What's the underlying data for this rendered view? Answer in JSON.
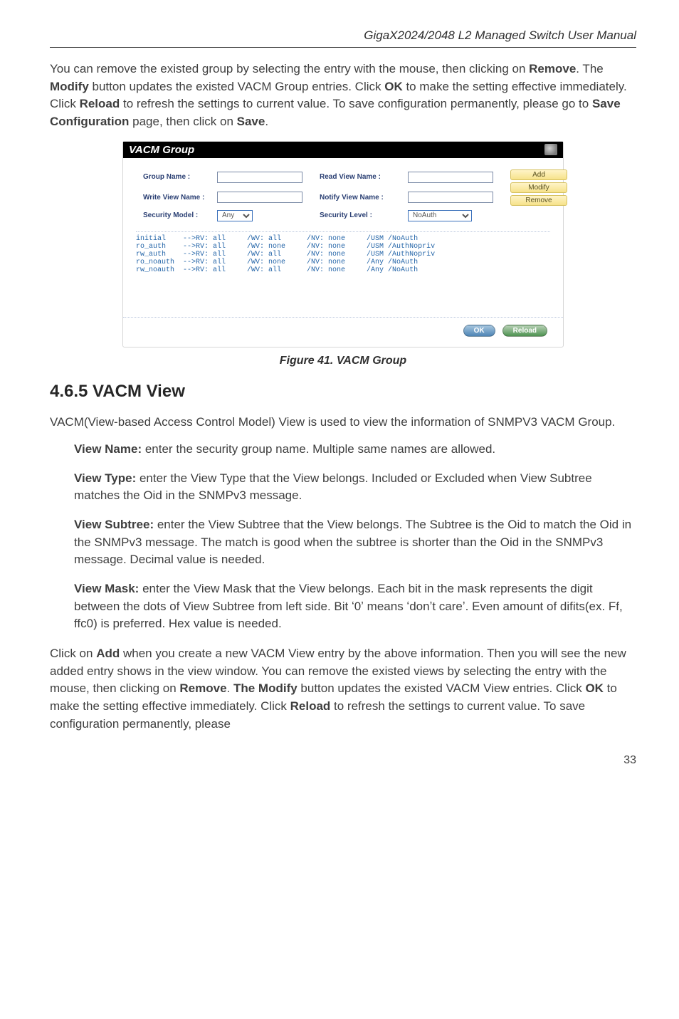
{
  "header": {
    "title": "GigaX2024/2048 L2 Managed Switch User Manual"
  },
  "intro_paragraph": {
    "t0": "You can remove the existed group by selecting the entry with the mouse, then clicking on ",
    "b1": "Remove",
    "t2": ". The ",
    "b3": "Modify",
    "t4": " button updates the existed VACM Group entries. Click ",
    "b5": "OK",
    "t6": " to make the setting effective immediately. Click ",
    "b7": "Reload",
    "t8": " to refresh the settings to current value. To save configuration permanently, please go to ",
    "b9": "Save Configuration",
    "t10": " page, then click on ",
    "b11": "Save",
    "t12": "."
  },
  "vacm": {
    "title": "VACM Group",
    "labels": {
      "group_name": "Group Name :",
      "read_view": "Read View Name :",
      "write_view": "Write View Name :",
      "notify_view": "Notify View Name :",
      "security_model": "Security Model :",
      "security_level": "Security Level :"
    },
    "selects": {
      "security_model_value": "Any",
      "security_level_value": "NoAuth"
    },
    "buttons": {
      "add": "Add",
      "modify": "Modify",
      "remove": "Remove",
      "ok": "OK",
      "reload": "Reload"
    },
    "rows": "initial    -->RV: all     /WV: all      /NV: none     /USM /NoAuth\nro_auth    -->RV: all     /WV: none     /NV: none     /USM /AuthNopriv\nrw_auth    -->RV: all     /WV: all      /NV: none     /USM /AuthNopriv\nro_noauth  -->RV: all     /WV: none     /NV: none     /Any /NoAuth\nrw_noauth  -->RV: all     /WV: all      /NV: none     /Any /NoAuth"
  },
  "figure_caption": "Figure 41. VACM Group",
  "section_heading": "4.6.5 VACM View",
  "section_intro": "VACM(View-based Access Control Model) View is used to view the information of SNMPV3 VACM Group.",
  "defs": {
    "view_name": {
      "label": "View Name:",
      "text": " enter the security group name. Multiple same names are allowed."
    },
    "view_type": {
      "label": "View Type:",
      "text": " enter the View Type that the View belongs. Included or Excluded when View Subtree matches the Oid in the SNMPv3 message."
    },
    "view_subtree": {
      "label": "View Subtree:",
      "text": " enter the View Subtree that the View belongs. The Subtree is the Oid to match the Oid in the SNMPv3 message. The match is good when the subtree is shorter than the Oid in the SNMPv3 message. Decimal value is needed."
    },
    "view_mask": {
      "label": "View Mask:",
      "text": " enter the View Mask that the View belongs. Each bit in the mask represents the digit between the dots of View Subtree from left side. Bit ʻ0ʼ means ʻdonʼt careʼ. Even amount of difits(ex. Ff, ffc0) is preferred. Hex value is needed."
    }
  },
  "closing_paragraph": {
    "t0": "Click on ",
    "b1": "Add",
    "t2": " when you create a new VACM View entry by the above information. Then you will see the new added entry shows in the view window. You can remove the existed views by selecting the entry with the mouse, then clicking on ",
    "b3": "Remove",
    "t4": ". ",
    "b5": "The Modify",
    "t6": " button updates the existed VACM View entries. Click ",
    "b7": "OK",
    "t8": " to make the setting effective immediately. Click ",
    "b9": "Reload",
    "t10": " to refresh the settings to current value. To save configuration permanently, please"
  },
  "page_number": "33"
}
